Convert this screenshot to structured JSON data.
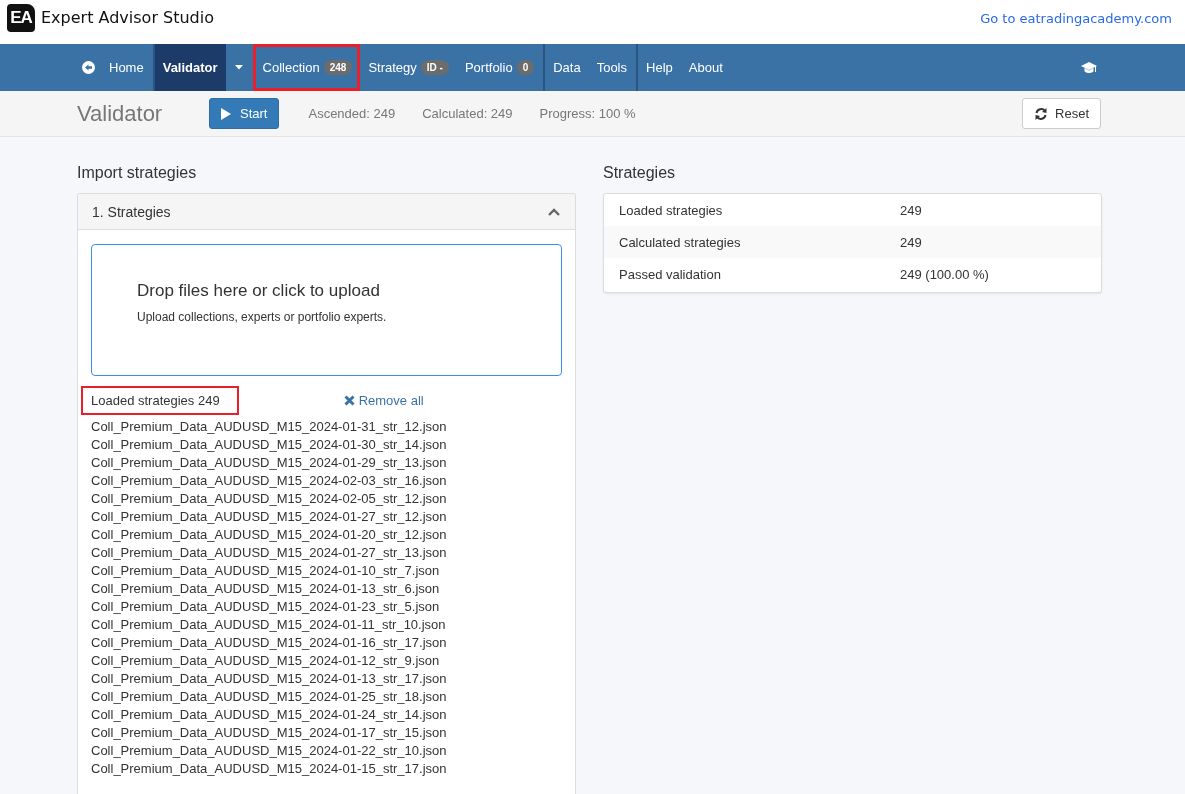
{
  "header": {
    "title": "Expert Advisor Studio",
    "logo_text": "EA",
    "link": "Go to eatradingacademy.com"
  },
  "nav": {
    "items": [
      {
        "kind": "home",
        "label": "Home",
        "selected": false,
        "highlighted": false,
        "separator_before": false
      },
      {
        "kind": "link",
        "label": "Validator",
        "selected": true,
        "highlighted": false,
        "separator_before": true
      },
      {
        "kind": "caret",
        "selected": false,
        "highlighted": false,
        "separator_before": false
      },
      {
        "kind": "link",
        "label": "Collection",
        "badge": "248",
        "selected": false,
        "highlighted": true,
        "separator_before": true
      },
      {
        "kind": "link",
        "label": "Strategy",
        "badge": "ID -",
        "selected": false,
        "highlighted": false,
        "separator_before": false
      },
      {
        "kind": "link",
        "label": "Portfolio",
        "badge": "0",
        "selected": false,
        "highlighted": false,
        "separator_before": false
      },
      {
        "kind": "link",
        "label": "Data",
        "selected": false,
        "highlighted": false,
        "separator_before": true
      },
      {
        "kind": "link",
        "label": "Tools",
        "selected": false,
        "highlighted": false,
        "separator_before": false
      },
      {
        "kind": "link",
        "label": "Help",
        "selected": false,
        "highlighted": false,
        "separator_before": true
      },
      {
        "kind": "link",
        "label": "About",
        "selected": false,
        "highlighted": false,
        "separator_before": false
      }
    ]
  },
  "toolbar": {
    "title": "Validator",
    "start_button": "Start",
    "stats": [
      "Ascended: 249",
      "Calculated: 249",
      "Progress: 100 %"
    ],
    "reset_button": "Reset"
  },
  "import": {
    "heading": "Import strategies",
    "panel_title": "1. Strategies",
    "expanded": true,
    "dropzone": {
      "title": "Drop files here or click to upload",
      "subtitle": "Upload collections, experts or portfolio experts."
    },
    "loaded_label": "Loaded strategies 249",
    "loaded_highlighted": true,
    "remove_all": "Remove all",
    "files": [
      "Coll_Premium_Data_AUDUSD_M15_2024-01-31_str_12.json",
      "Coll_Premium_Data_AUDUSD_M15_2024-01-30_str_14.json",
      "Coll_Premium_Data_AUDUSD_M15_2024-01-29_str_13.json",
      "Coll_Premium_Data_AUDUSD_M15_2024-02-03_str_16.json",
      "Coll_Premium_Data_AUDUSD_M15_2024-02-05_str_12.json",
      "Coll_Premium_Data_AUDUSD_M15_2024-01-27_str_12.json",
      "Coll_Premium_Data_AUDUSD_M15_2024-01-20_str_12.json",
      "Coll_Premium_Data_AUDUSD_M15_2024-01-27_str_13.json",
      "Coll_Premium_Data_AUDUSD_M15_2024-01-10_str_7.json",
      "Coll_Premium_Data_AUDUSD_M15_2024-01-13_str_6.json",
      "Coll_Premium_Data_AUDUSD_M15_2024-01-23_str_5.json",
      "Coll_Premium_Data_AUDUSD_M15_2024-01-11_str_10.json",
      "Coll_Premium_Data_AUDUSD_M15_2024-01-16_str_17.json",
      "Coll_Premium_Data_AUDUSD_M15_2024-01-12_str_9.json",
      "Coll_Premium_Data_AUDUSD_M15_2024-01-13_str_17.json",
      "Coll_Premium_Data_AUDUSD_M15_2024-01-25_str_18.json",
      "Coll_Premium_Data_AUDUSD_M15_2024-01-24_str_14.json",
      "Coll_Premium_Data_AUDUSD_M15_2024-01-17_str_15.json",
      "Coll_Premium_Data_AUDUSD_M15_2024-01-22_str_10.json",
      "Coll_Premium_Data_AUDUSD_M15_2024-01-15_str_17.json"
    ]
  },
  "strategies": {
    "heading": "Strategies",
    "rows": [
      {
        "label": "Loaded strategies",
        "value": "249"
      },
      {
        "label": "Calculated strategies",
        "value": "249"
      },
      {
        "label": "Passed validation",
        "value": "249 (100.00 %)"
      }
    ]
  }
}
